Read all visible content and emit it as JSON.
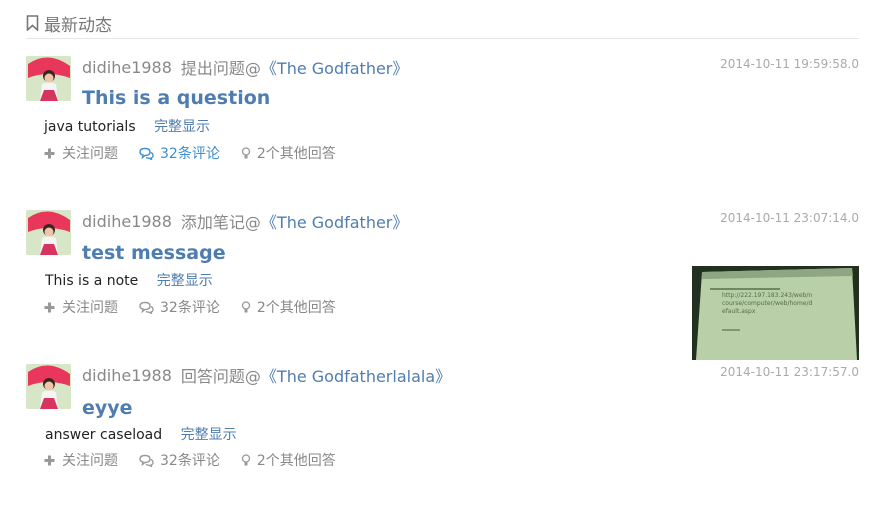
{
  "header": {
    "title": "最新动态"
  },
  "feed": [
    {
      "username": "didihe1988",
      "action": "提出问题@",
      "target": "《The Godfather》",
      "timestamp": "2014-10-11 19:59:58.0",
      "title": "This is a question",
      "body": "java tutorials",
      "show_full": "完整显示",
      "follow": "关注问题",
      "comments": "32条评论",
      "answers": "2个其他回答"
    },
    {
      "username": "didihe1988",
      "action": "添加笔记@",
      "target": "《The Godfather》",
      "timestamp": "2014-10-11 23:07:14.0",
      "title": "test message",
      "body": "This is a note",
      "show_full": "完整显示",
      "follow": "关注问题",
      "comments": "32条评论",
      "answers": "2个其他回答",
      "thumbnail_text": "http://222.197.183.243/web/n course/computer/web/home/d efault.aspx"
    },
    {
      "username": "didihe1988",
      "action": "回答问题@",
      "target": "《The Godfatherlalala》",
      "timestamp": "2014-10-11 23:17:57.0",
      "title": "eyye",
      "body": "answer caseload",
      "show_full": "完整显示",
      "follow": "关注问题",
      "comments": "32条评论",
      "answers": "2个其他回答"
    }
  ],
  "colors": {
    "link": "#4f7db0",
    "active_link": "#3e8ed0",
    "muted": "#888888"
  },
  "icons": {
    "header": "bookmark-icon",
    "follow": "plus-icon",
    "comments": "chat-bubbles-icon",
    "answers": "lightbulb-icon"
  }
}
